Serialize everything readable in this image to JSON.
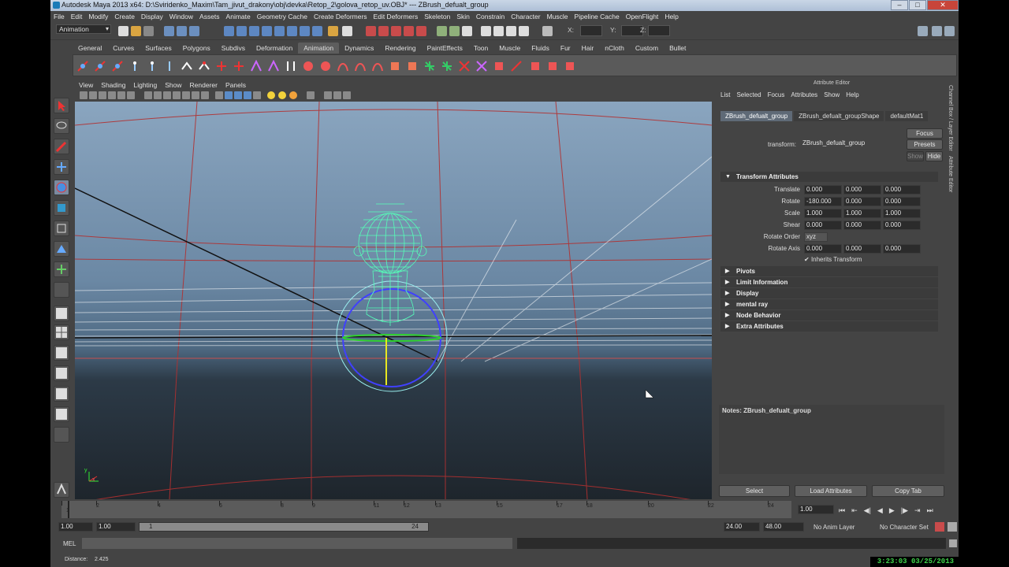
{
  "window": {
    "title": "Autodesk Maya 2013 x64: D:\\Sviridenko_Maxim\\Tam_jivut_drakony\\obj\\devka\\Retop_2\\golova_retop_uv.OBJ*   ---   ZBrush_defualt_group",
    "min": "–",
    "max": "□",
    "close": "✕"
  },
  "menubar": [
    "File",
    "Edit",
    "Modify",
    "Create",
    "Display",
    "Window",
    "Assets",
    "Animate",
    "Geometry Cache",
    "Create Deformers",
    "Edit Deformers",
    "Skeleton",
    "Skin",
    "Constrain",
    "Character",
    "Muscle",
    "Pipeline Cache",
    "OpenFlight",
    "Help"
  ],
  "statusline": {
    "mode": "Animation",
    "x_label": "X:",
    "y_label": "Y:",
    "z_label": "Z:"
  },
  "shelf_tabs": [
    "General",
    "Curves",
    "Surfaces",
    "Polygons",
    "Subdivs",
    "Deformation",
    "Animation",
    "Dynamics",
    "Rendering",
    "PaintEffects",
    "Toon",
    "Muscle",
    "Fluids",
    "Fur",
    "Hair",
    "nCloth",
    "Custom",
    "Bullet"
  ],
  "shelf_active": "Animation",
  "viewport": {
    "menu": [
      "View",
      "Shading",
      "Lighting",
      "Show",
      "Renderer",
      "Panels"
    ],
    "axis_x": "x",
    "axis_y": "y"
  },
  "attribute_editor": {
    "header": "Attribute Editor",
    "menu": [
      "List",
      "Selected",
      "Focus",
      "Attributes",
      "Show",
      "Help"
    ],
    "tabs": [
      "ZBrush_defualt_group",
      "ZBrush_defualt_groupShape",
      "defaultMat1"
    ],
    "active_tab": "ZBrush_defualt_group",
    "transform_label": "transform:",
    "transform_value": "ZBrush_defualt_group",
    "focus_btn": "Focus",
    "presets_btn": "Presets",
    "show_btn": "Show",
    "hide_btn": "Hide",
    "transform_section": "Transform Attributes",
    "translate": {
      "label": "Translate",
      "x": "0.000",
      "y": "0.000",
      "z": "0.000"
    },
    "rotate": {
      "label": "Rotate",
      "x": "-180.000",
      "y": "0.000",
      "z": "0.000"
    },
    "scale": {
      "label": "Scale",
      "x": "1.000",
      "y": "1.000",
      "z": "1.000"
    },
    "shear": {
      "label": "Shear",
      "x": "0.000",
      "y": "0.000",
      "z": "0.000"
    },
    "rotate_order": {
      "label": "Rotate Order",
      "value": "xyz"
    },
    "rotate_axis": {
      "label": "Rotate Axis",
      "x": "0.000",
      "y": "0.000",
      "z": "0.000"
    },
    "inherits_transform": "Inherits Transform",
    "sections": [
      "Pivots",
      "Limit Information",
      "Display",
      "mental ray",
      "Node Behavior",
      "Extra Attributes"
    ],
    "notes": "Notes:  ZBrush_defualt_group",
    "bottom_buttons": [
      "Select",
      "Load Attributes",
      "Copy Tab"
    ],
    "side_tabs": [
      "Channel Box / Layer Editor",
      "Attribute Editor"
    ]
  },
  "timeline": {
    "ticks": [
      "1",
      "2",
      "4",
      "6",
      "8",
      "9",
      "11",
      "12",
      "13",
      "15",
      "17",
      "18",
      "20",
      "22",
      "24"
    ],
    "current_frame": "1.00",
    "playback_icons": [
      "go-start-icon",
      "step-back-key-icon",
      "step-back-icon",
      "play-back-icon",
      "play-forward-icon",
      "step-forward-icon",
      "step-forward-key-icon",
      "go-end-icon"
    ]
  },
  "range": {
    "start": "1.00",
    "playback_start": "1.00",
    "slider_start": "1",
    "slider_end": "24",
    "playback_end": "24.00",
    "end": "48.00",
    "anim_layer": "No Anim Layer",
    "character_set": "No Character Set"
  },
  "mel_label": "MEL",
  "helpline": {
    "label": "Distance:",
    "value": "2.425"
  },
  "clock": "3:23:03  03/25/2013"
}
